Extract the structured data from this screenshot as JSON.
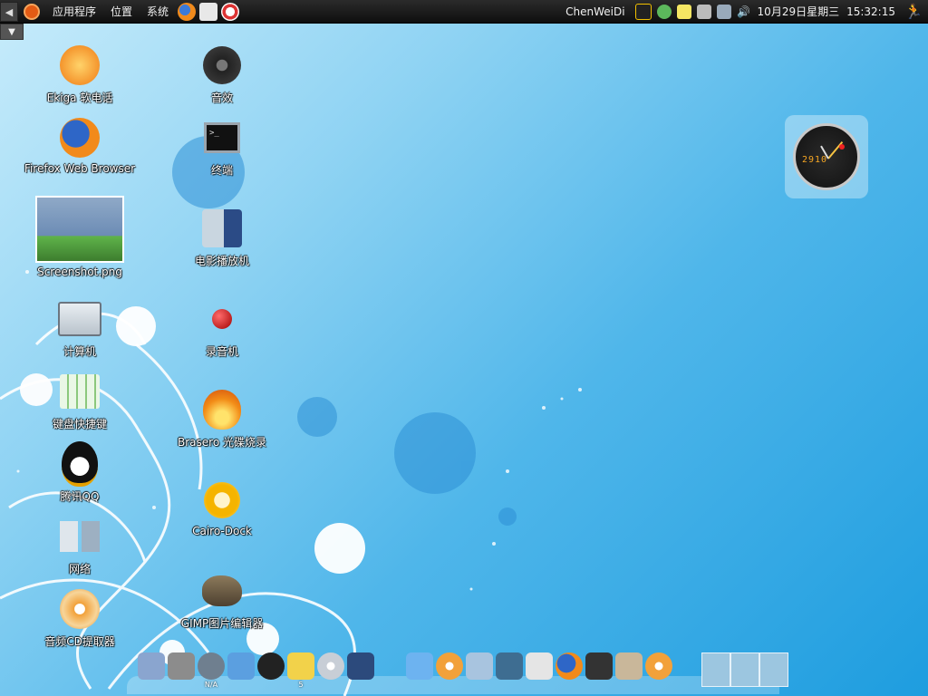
{
  "top_panel": {
    "menus": [
      "应用程序",
      "位置",
      "系统"
    ],
    "username": "ChenWeiDi",
    "date": "10月29日星期三",
    "time": "15:32:15",
    "launchers": [
      "firefox-icon",
      "mail-icon",
      "help-icon"
    ],
    "tray": [
      "qq-tray-icon",
      "pidgin-icon",
      "notes-icon",
      "keyboard-icon",
      "network-icon",
      "volume-icon"
    ],
    "accent": "#e35b14"
  },
  "desktop_icons_left": [
    {
      "label": "Ekiga 软电话",
      "icon": "ekiga-icon"
    },
    {
      "label": "Firefox Web Browser",
      "icon": "firefox-icon"
    },
    {
      "label": "Screenshot.png",
      "icon": "screenshot-thumbnail"
    },
    {
      "label": "计算机",
      "icon": "computer-icon"
    },
    {
      "label": "键盘快捷键",
      "icon": "keyboard-shortcuts-icon"
    },
    {
      "label": "腾讯QQ",
      "icon": "qq-icon"
    },
    {
      "label": "网络",
      "icon": "network-icon"
    },
    {
      "label": "音频CD提取器",
      "icon": "cd-ripper-icon"
    }
  ],
  "desktop_icons_right": [
    {
      "label": "音效",
      "icon": "sound-icon"
    },
    {
      "label": "终端",
      "icon": "terminal-icon"
    },
    {
      "label": "电影播放机",
      "icon": "movie-player-icon"
    },
    {
      "label": "录音机",
      "icon": "sound-recorder-icon"
    },
    {
      "label": "Brasero 光碟烧录",
      "icon": "brasero-icon"
    },
    {
      "label": "Cairo-Dock",
      "icon": "cairo-dock-icon"
    },
    {
      "label": "GIMP图片编辑器",
      "icon": "gimp-icon"
    }
  ],
  "clock_widget": {
    "date_text": "2910"
  },
  "dock": {
    "items": [
      "trash-icon",
      "recycle-icon",
      "weather-icon",
      "music-icon",
      "speaker-icon",
      "folder-icon",
      "cd-icon",
      "monitor-icon",
      "twitter-icon",
      "cd-burn-icon",
      "home-icon",
      "screen-icon",
      "mail-icon",
      "firefox-icon",
      "ipod-icon",
      "package-icon",
      "cd2-icon"
    ],
    "na_label": "N/A",
    "folder_badge": "5",
    "desktops": [
      "desktop-1",
      "desktop-2",
      "desktop-3"
    ]
  }
}
